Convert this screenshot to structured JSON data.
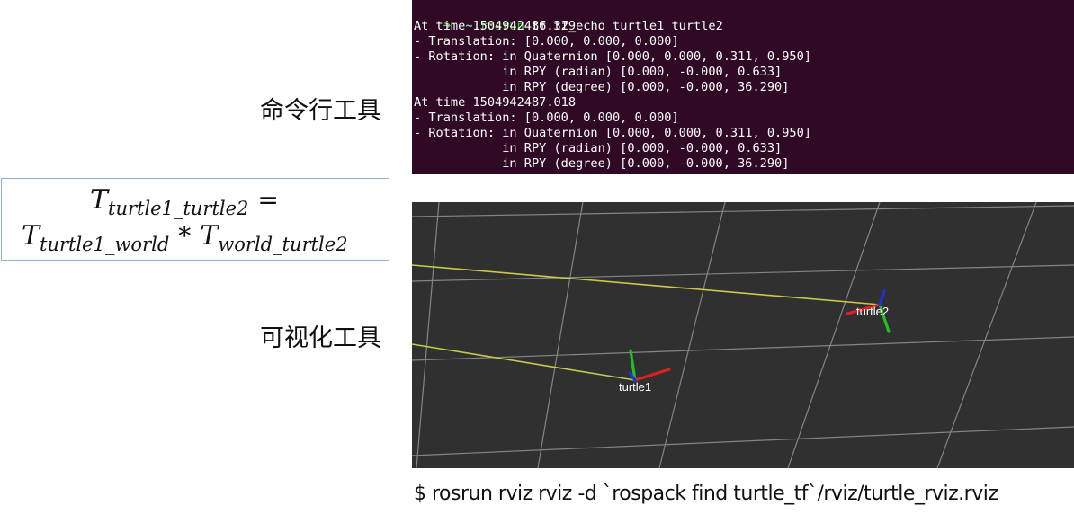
{
  "labels": {
    "command_line_tool": "命令行工具",
    "visualization_tool": "可视化工具"
  },
  "formula": {
    "line1": {
      "lhs": "T",
      "lhs_sub": "turtle1_turtle2",
      "equals": "="
    },
    "line2": {
      "a": "T",
      "a_sub": "turtle1_world",
      "times": "*",
      "b": "T",
      "b_sub": "world_turtle2"
    }
  },
  "terminal": {
    "prompt_arrow": "➜",
    "prompt_dir": "~",
    "command_name": "rosrun",
    "command_args": " tf tf_echo turtle1 turtle2",
    "lines": [
      "At time 1504942486.329",
      "- Translation: [0.000, 0.000, 0.000]",
      "- Rotation: in Quaternion [0.000, 0.000, 0.311, 0.950]",
      "            in RPY (radian) [0.000, -0.000, 0.633]",
      "            in RPY (degree) [0.000, -0.000, 36.290]",
      "At time 1504942487.018",
      "- Translation: [0.000, 0.000, 0.000]",
      "- Rotation: in Quaternion [0.000, 0.000, 0.311, 0.950]",
      "            in RPY (radian) [0.000, -0.000, 0.633]",
      "            in RPY (degree) [0.000, -0.000, 36.290]"
    ],
    "colors": {
      "background": "#300a24",
      "prompt": "#4ee44e",
      "text": "#ffffff"
    }
  },
  "rviz": {
    "frames": {
      "turtle1": "turtle1",
      "turtle2": "turtle2"
    },
    "colors": {
      "background": "#303030",
      "grid": "#a0a0a0",
      "tf_link": "#c8c84a",
      "x_axis": "#e02020",
      "y_axis": "#20c020",
      "z_axis": "#2030e0"
    }
  },
  "caption": "$ rosrun rviz rviz -d `rospack find turtle_tf`/rviz/turtle_rviz.rviz"
}
